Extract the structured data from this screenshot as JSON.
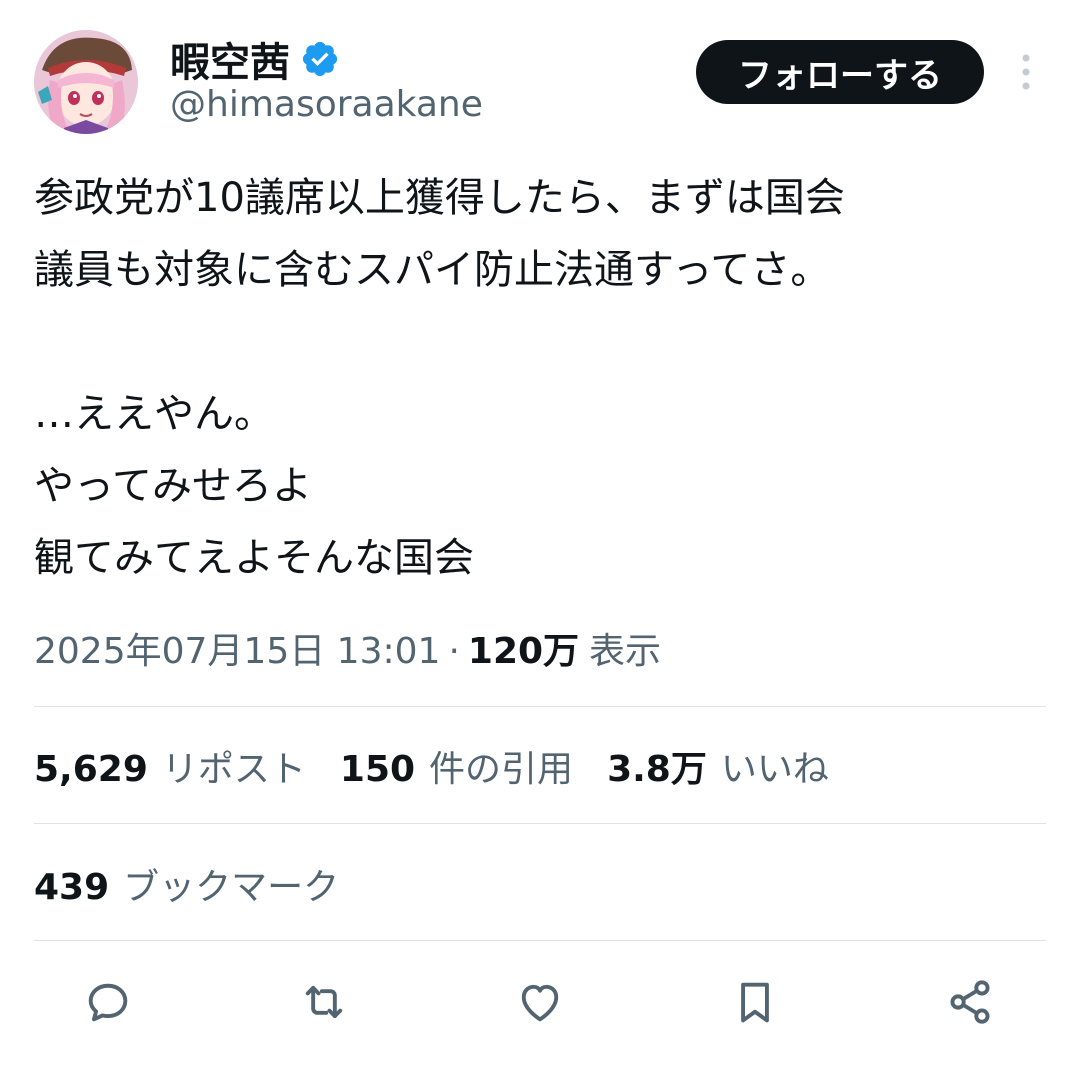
{
  "author": {
    "display_name": "暇空茜",
    "handle": "@himasoraakane",
    "avatar": "anime-girl-avatar",
    "verified_icon": "verified-badge-icon",
    "verified_color": "#1d9bf0"
  },
  "header": {
    "follow_label": "フォローする",
    "more_icon": "more-vertical-icon"
  },
  "tweet": {
    "lines": [
      "参政党が10議席以上獲得したら、まずは国会",
      "議員も対象に含むスパイ防止法通すってさ。",
      "",
      "…ええやん。",
      "やってみせろよ",
      "観てみてえよそんな国会"
    ]
  },
  "meta": {
    "timestamp": "2025年07月15日 13:01",
    "separator": "·",
    "views_count": "120万",
    "views_label": "表示"
  },
  "stats": {
    "reposts": {
      "count": "5,629",
      "label": "リポスト"
    },
    "quotes": {
      "count": "150",
      "label": "件の引用"
    },
    "likes": {
      "count": "3.8万",
      "label": "いいね"
    },
    "bookmarks": {
      "count": "439",
      "label": "ブックマーク"
    }
  },
  "actions": {
    "icons": [
      "reply-icon",
      "repost-icon",
      "like-icon",
      "bookmark-icon",
      "share-icon"
    ],
    "icon_color": "#536471"
  },
  "colors": {
    "text_primary": "#0f1419",
    "text_secondary": "#536471",
    "divider": "#dfe3e6",
    "button_bg": "#0f1419"
  }
}
